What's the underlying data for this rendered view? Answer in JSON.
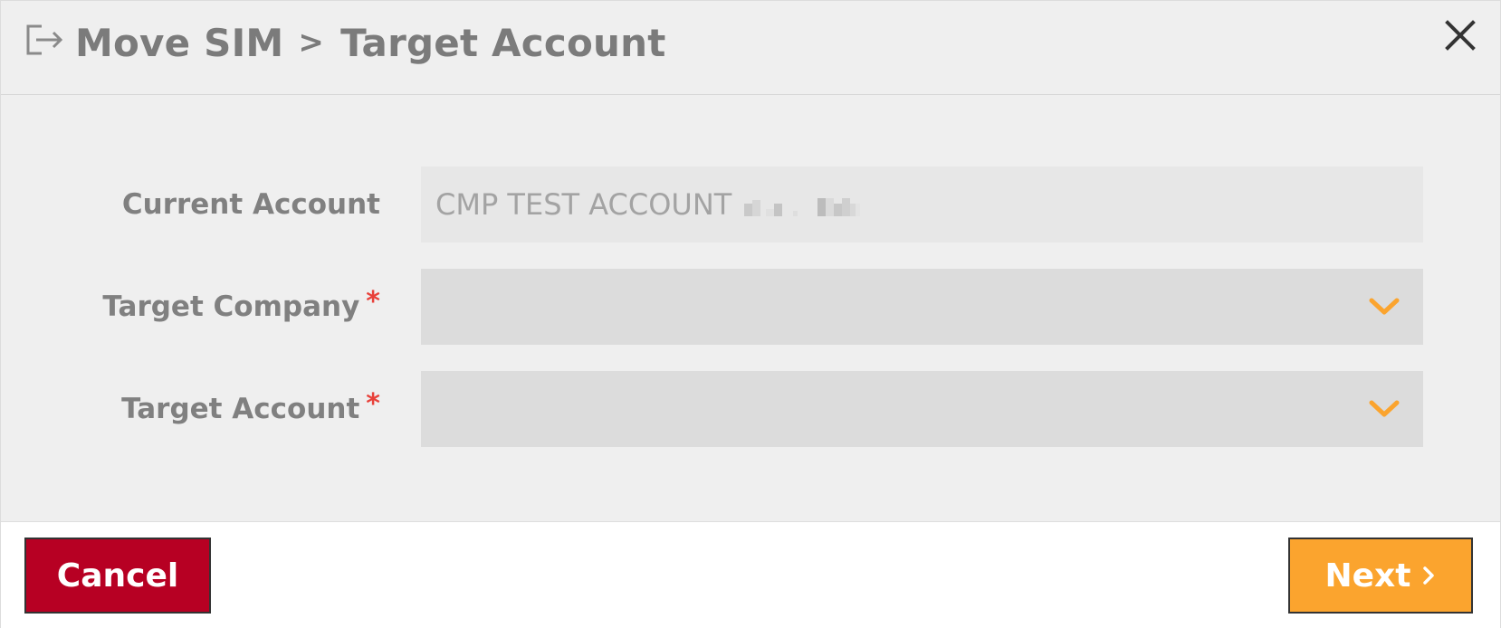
{
  "header": {
    "icon": "exit-arrow-icon",
    "title_part1": "Move SIM",
    "separator": ">",
    "title_part2": "Target Account",
    "close_icon": "close-icon"
  },
  "form": {
    "current_account": {
      "label": "Current Account",
      "value": "CMP TEST ACCOUNT"
    },
    "target_company": {
      "label": "Target Company",
      "required_mark": "*",
      "value": "",
      "icon": "chevron-down-icon"
    },
    "target_account": {
      "label": "Target Account",
      "required_mark": "*",
      "value": "",
      "icon": "chevron-down-icon"
    }
  },
  "footer": {
    "cancel_label": "Cancel",
    "next_label": "Next",
    "next_icon": "chevron-right-icon"
  },
  "colors": {
    "accent_orange": "#fba42e",
    "cancel_red": "#b70023",
    "required_red": "#e8413a",
    "label_gray": "#808080"
  }
}
